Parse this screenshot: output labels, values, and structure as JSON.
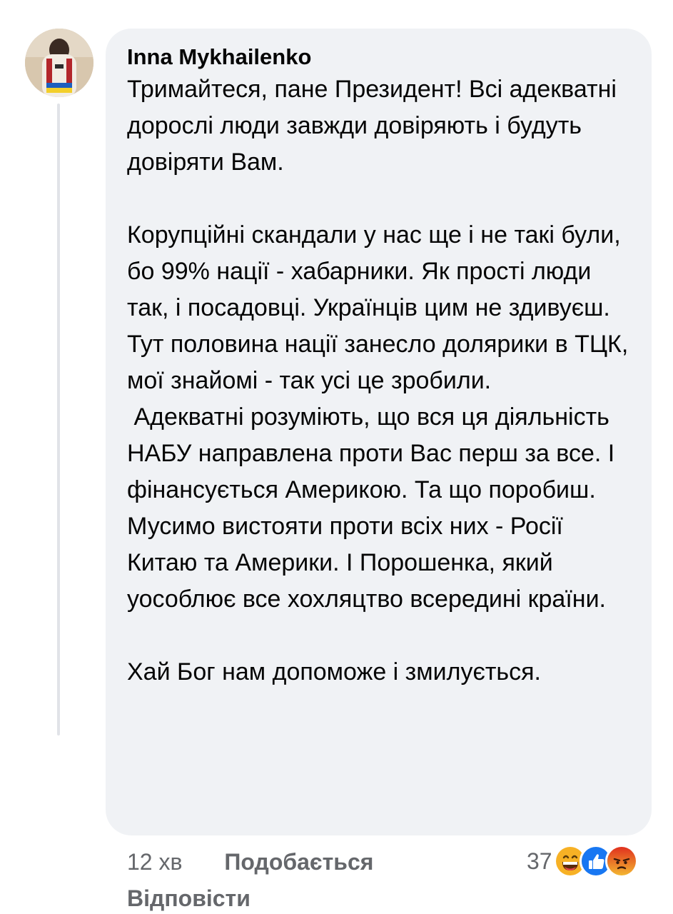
{
  "comment": {
    "author": "Inna Mykhailenko",
    "paragraphs": [
      "Тримайтеся, пане Президент! Всі адекватні дорослі люди завжди довіряють і будуть довіряти Вам.",
      "",
      "Корупційні скандали у нас ще і не такі були, бо 99% нації - хабарники. Як прості люди так, і посадовці. Українців цим не здивуєш. Тут половина нації занесло долярики в ТЦК, мої знайомі - так усі це зробили.",
      " Адекватні розуміють, що вся ця діяльність НАБУ направлена проти Вас перш за все. І фінансується Америкою. Та що поробиш. Мусимо вистояти проти всіх них - Росії Китаю та Америки. І Порошенка, який уособлює все хохляцтво всередині країни.",
      "",
      "Хай Бог нам допоможе і змилується."
    ]
  },
  "footer": {
    "time": "12 хв",
    "like_label": "Подобається",
    "reply_label": "Відповісти"
  },
  "reactions": {
    "count": "37",
    "icons": [
      "haha-icon",
      "like-icon",
      "angry-icon"
    ],
    "colors": {
      "haha": "#f7b125",
      "like": "#1877f2",
      "angry": "#e9710f"
    }
  },
  "colors": {
    "bubble": "#f0f2f5",
    "meta_text": "#65676b",
    "thread_line": "#e1e3e8"
  }
}
